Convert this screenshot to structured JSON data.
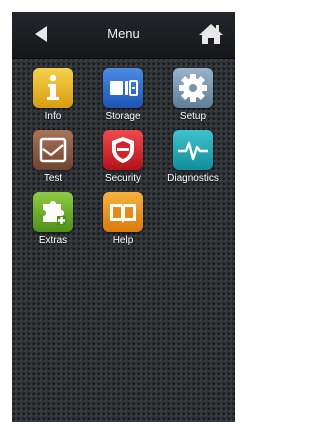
{
  "header": {
    "title": "Menu",
    "back_icon": "back-arrow-icon",
    "home_icon": "home-icon"
  },
  "menu": {
    "items": [
      {
        "label": "Info",
        "icon": "info-icon",
        "color": "#e9b61e"
      },
      {
        "label": "Storage",
        "icon": "storage-icon",
        "color": "#2f6fcf"
      },
      {
        "label": "Setup",
        "icon": "gear-icon",
        "color": "#6f8fa8"
      },
      {
        "label": "Test",
        "icon": "test-icon",
        "color": "#8a5a44"
      },
      {
        "label": "Security",
        "icon": "shield-icon",
        "color": "#d8262c"
      },
      {
        "label": "Diagnostics",
        "icon": "pulse-icon",
        "color": "#22a7b4"
      },
      {
        "label": "Extras",
        "icon": "puzzle-icon",
        "color": "#6cae2a"
      },
      {
        "label": "Help",
        "icon": "book-icon",
        "color": "#e9931c"
      }
    ]
  }
}
